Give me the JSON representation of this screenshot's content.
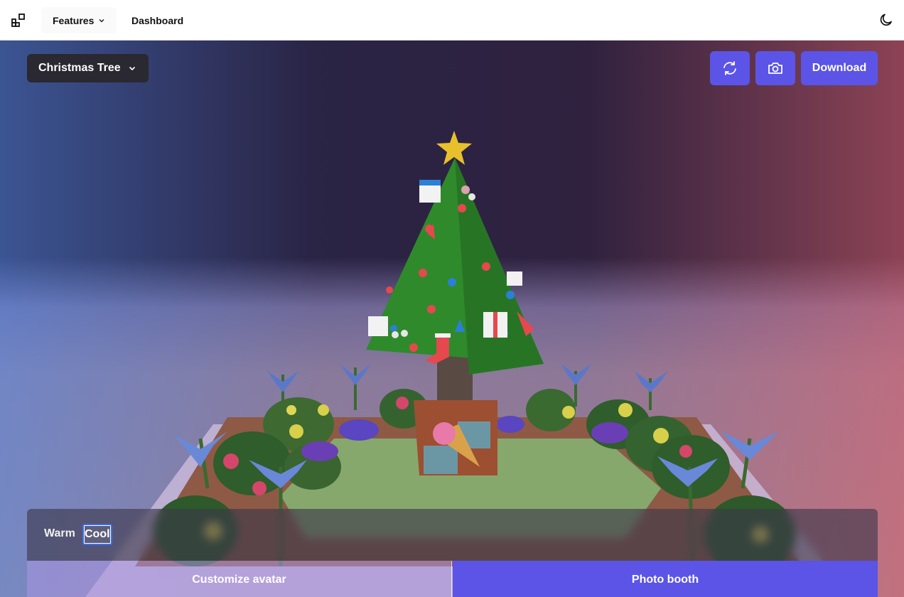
{
  "nav": {
    "logo_icon": "apps-grid-icon",
    "features_label": "Features",
    "dashboard_label": "Dashboard",
    "theme_icon": "moon-icon"
  },
  "toolbar": {
    "scene_select": "Christmas Tree",
    "refresh_icon": "refresh-icon",
    "camera_icon": "camera-icon",
    "download_label": "Download"
  },
  "lighting": {
    "options": [
      "Warm",
      "Cool"
    ],
    "selected": "Cool"
  },
  "tabs": {
    "customize_label": "Customize avatar",
    "photo_label": "Photo booth",
    "active": "Photo booth"
  },
  "colors": {
    "accent": "#5b54e6",
    "scene_dark": "#16112e",
    "foliage": "#2f8a2c",
    "star": "#e8c02c"
  }
}
